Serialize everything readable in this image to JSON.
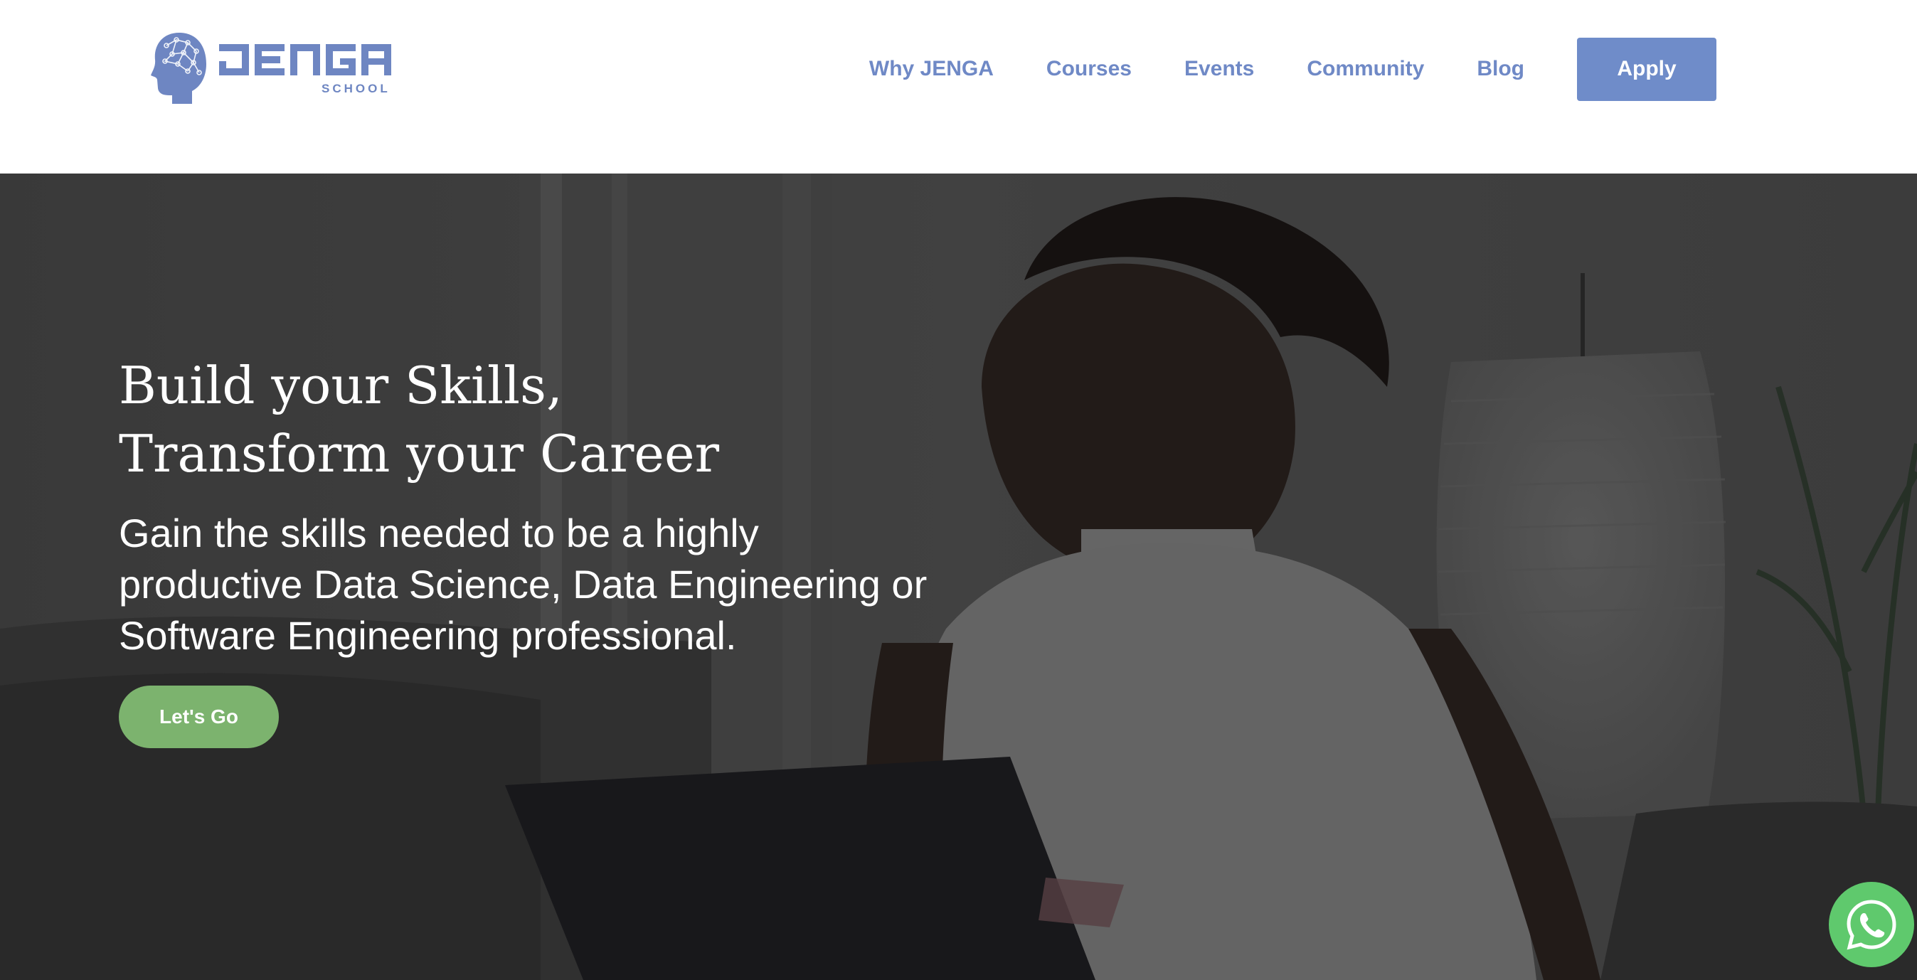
{
  "header": {
    "logo": {
      "wordmark": "JENGA",
      "sub": "SCHOOL",
      "icon": "brain-head-icon"
    },
    "nav": [
      {
        "label": "Why JENGA"
      },
      {
        "label": "Courses"
      },
      {
        "label": "Events"
      },
      {
        "label": "Community"
      },
      {
        "label": "Blog"
      }
    ],
    "apply_label": "Apply"
  },
  "hero": {
    "title_line1": "Build your Skills,",
    "title_line2": "Transform your Career",
    "subtitle": "Gain the skills needed to be a highly productive Data Science, Data Engineering or Software Engineering professional.",
    "cta_label": "Let's Go",
    "background": "woman-working-on-laptop-photo"
  },
  "floating": {
    "whatsapp_icon": "whatsapp-icon"
  },
  "colors": {
    "brand_blue": "#6f89c6",
    "cta_green": "#7cb36e",
    "whatsapp_green": "#5fc96d",
    "hero_overlay": "#3a3a3a"
  }
}
